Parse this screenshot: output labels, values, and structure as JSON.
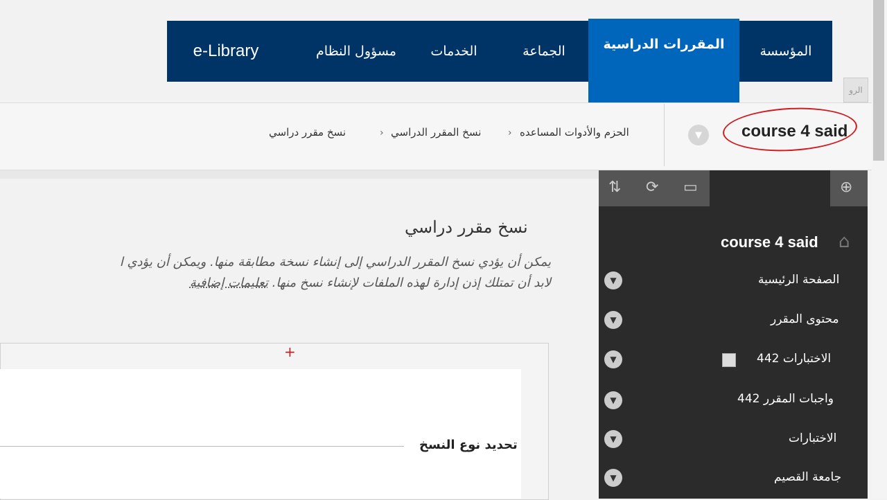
{
  "nav": {
    "tabs": [
      {
        "label": "المؤسسة"
      },
      {
        "label": "المقررات الدراسية"
      },
      {
        "label": "الجماعة"
      },
      {
        "label": "الخدمات"
      },
      {
        "label": "مسؤول النظام"
      },
      {
        "label": "e-Library"
      }
    ],
    "active_index": 1,
    "side_button_label": "الرو"
  },
  "breadcrumb": {
    "course_title": "course 4 said",
    "items": [
      "الحزم والأدوات المساعده",
      "نسخ المقرر الدراسي",
      "نسخ مقرر دراسي"
    ]
  },
  "sidebar": {
    "course_name": "course 4 said",
    "items": [
      {
        "label": "الصفحة الرئيسية"
      },
      {
        "label": "محتوى المقرر"
      },
      {
        "label": "الاختبارات 442"
      },
      {
        "label": "واجبات المقرر 442"
      },
      {
        "label": "الاختبارات"
      },
      {
        "label": "جامعة القصيم"
      }
    ]
  },
  "main": {
    "heading": "نسخ مقرر دراسي",
    "description_line1": "يمكن أن يؤدي نسخ المقرر الدراسي إلى إنشاء نسخة مطابقة منها. ويمكن أن يؤدي ا",
    "description_line2": "لابد أن تمتلك إذن إدارة لهذه الملفات لإنشاء نسخ منها.",
    "more_help_link": "تعليمات إضافية",
    "section_title": "تحديد نوع النسخ"
  },
  "colors": {
    "nav_bg": "#003366",
    "nav_active": "#0066bb",
    "sidebar_bg": "#2b2b2b",
    "annotation_red": "#d2191e"
  }
}
